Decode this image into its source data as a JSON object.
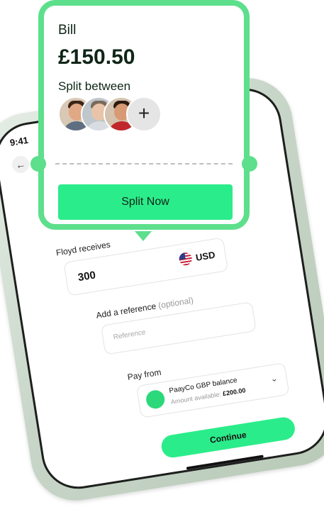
{
  "status_bar": {
    "time": "9:41"
  },
  "nav": {
    "back_icon": "←"
  },
  "transfer": {
    "receiver_label": "Floyd receives",
    "amount": "300",
    "currency": "USD",
    "reference_label": "Add a reference",
    "reference_optional": "(optional)",
    "reference_placeholder": "Reference",
    "pay_from_label": "Pay from",
    "account_name": "PaayCo GBP balance",
    "available_label": "Amount available:",
    "available_value": "£200.00",
    "continue_label": "Continue"
  },
  "bill": {
    "title": "Bill",
    "amount": "£150.50",
    "split_label": "Split between",
    "participants": [
      {
        "shirt": "#5f6f82",
        "skin": "#e0a884",
        "hair": "#3a2418",
        "bg": "#d8c8b4"
      },
      {
        "shirt": "#d9dde2",
        "skin": "#e9c4a8",
        "hair": "#7a6a5a",
        "bg": "#bfc6cc"
      },
      {
        "shirt": "#c0282c",
        "skin": "#d89a74",
        "hair": "#2a1a10",
        "bg": "#d4c2ae"
      }
    ],
    "add_icon": "+",
    "split_button": "Split Now"
  },
  "colors": {
    "accent": "#2bec8a",
    "card_border": "#5ddf8c"
  }
}
